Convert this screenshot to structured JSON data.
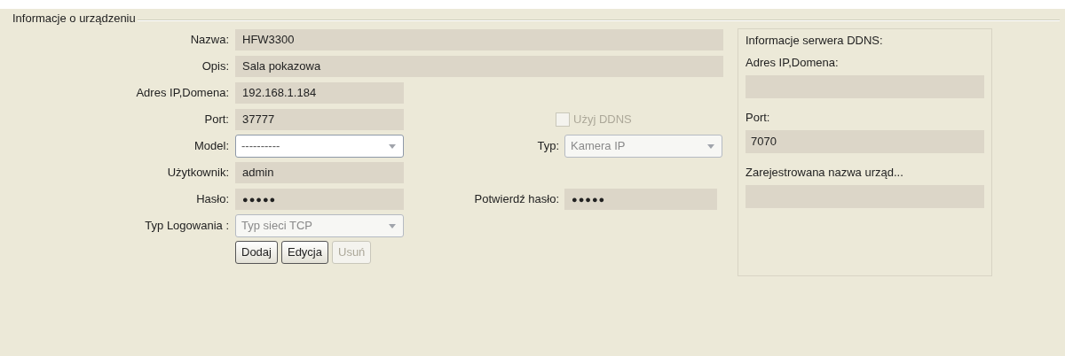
{
  "group_title": "Informacje o urządzeniu",
  "rows": [
    {
      "label": "Nazwa:",
      "control": {
        "kind": "text",
        "value": "HFW3300",
        "wide": true
      }
    },
    {
      "label": "Opis:",
      "control": {
        "kind": "text",
        "value": "Sala pokazowa",
        "wide": true
      }
    },
    {
      "label": "Adres IP,Domena:",
      "control": {
        "kind": "text",
        "value": "192.168.1.184",
        "wide": false
      }
    },
    {
      "label": "Port:",
      "control": {
        "kind": "text",
        "value": "37777",
        "wide": false
      },
      "right": {
        "kind": "checkbox",
        "text": "Użyj DDNS",
        "checked": false,
        "disabled": true
      }
    },
    {
      "label": "Model:",
      "control": {
        "kind": "select",
        "value": "----------",
        "disabled": false
      },
      "right": {
        "kind": "select",
        "label": "Typ:",
        "value": "Kamera IP",
        "disabled": true
      }
    },
    {
      "label": "Użytkownik:",
      "control": {
        "kind": "text",
        "value": "admin",
        "wide": false
      }
    },
    {
      "label": "Hasło:",
      "control": {
        "kind": "password",
        "value": "●●●●●",
        "wide": false
      },
      "right": {
        "kind": "password",
        "label": "Potwierdź hasło:",
        "value": "●●●●●"
      }
    },
    {
      "label": "Typ Logowania :",
      "control": {
        "kind": "select",
        "value": "Typ sieci TCP",
        "disabled": true
      }
    }
  ],
  "buttons": [
    {
      "label": "Dodaj",
      "disabled": false
    },
    {
      "label": "Edycja",
      "disabled": false
    },
    {
      "label": "Usuń",
      "disabled": true
    }
  ],
  "ddns": {
    "title": "Informacje serwera DDNS:",
    "fields": [
      {
        "label": "Adres IP,Domena:"
      },
      {
        "label": "Port:",
        "value": "7070"
      },
      {
        "label": "Zarejestrowana nazwa urząd..."
      }
    ]
  }
}
